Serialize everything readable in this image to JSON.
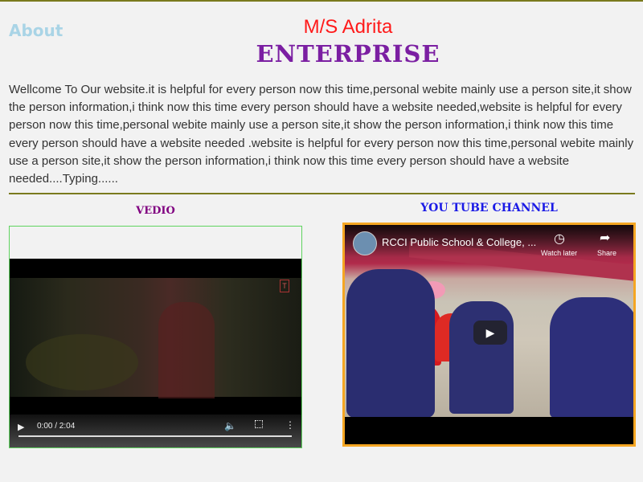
{
  "header": {
    "about": "About",
    "brand_name": "M/S Adrita",
    "brand_sub": "ENTERPRISE"
  },
  "intro": "Wellcome To Our website.it is helpful for every person now this time,personal webite mainly use a person site,it show the person information,i think now this time every person should have a website needed,website is helpful for every person now this time,personal webite mainly use a person site,it show the person information,i think now this time every person should have a website needed .website is helpful for every person now this time,personal webite mainly use a person site,it show the person information,i think now this time every person should have a website needed....Typing......",
  "video_section": {
    "title": "VEDIO",
    "time": "0:00 / 2:04",
    "brand_mark": "T"
  },
  "youtube_section": {
    "title": "YOU TUBE CHANNEL",
    "video_title": "RCCI Public School & College, ...",
    "watch_later": "Watch later",
    "share": "Share"
  },
  "colors": {
    "about": "#a9d4e6",
    "brand_name": "#ff1a1a",
    "brand_sub": "#7b1fa2",
    "vedio_title": "#800080",
    "youtube_title": "#1a1ae6",
    "video_border": "#5fd35f",
    "youtube_border": "#f5a623",
    "rule": "#7a7a1e"
  },
  "icons": [
    "play-icon",
    "volume-icon",
    "fullscreen-icon",
    "more-options-icon",
    "clock-icon",
    "share-icon",
    "youtube-play-icon"
  ]
}
